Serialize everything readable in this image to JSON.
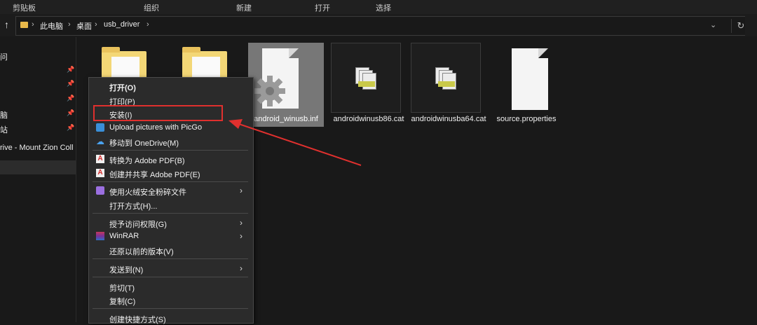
{
  "ribbon": [
    "剪贴板",
    "组织",
    "新建",
    "打开",
    "选择"
  ],
  "breadcrumb": [
    "此电脑",
    "桌面",
    "usb_driver"
  ],
  "nav": {
    "items": [
      {
        "label": "问",
        "pinned": false
      },
      {
        "label": "",
        "pinned": true
      },
      {
        "label": "",
        "pinned": true
      },
      {
        "label": "",
        "pinned": true
      },
      {
        "label": "脑",
        "pinned": true
      },
      {
        "label": "站",
        "pinned": true
      },
      {
        "label": "rive - Mount Zion Coll",
        "pinned": false
      },
      {
        "label": "",
        "pinned": false
      }
    ]
  },
  "files": [
    {
      "name": "",
      "type": "folder"
    },
    {
      "name": "",
      "type": "folder"
    },
    {
      "name": "android_winusb.inf",
      "type": "inf"
    },
    {
      "name": "androidwinusb86.cat",
      "type": "cat"
    },
    {
      "name": "androidwinusba64.cat",
      "type": "cat"
    },
    {
      "name": "source.properties",
      "type": "document"
    }
  ],
  "menu": {
    "items": [
      {
        "label": "打开(O)",
        "bold": true,
        "icon": "",
        "arrow": false
      },
      {
        "label": "打印(P)",
        "icon": "",
        "arrow": false
      },
      {
        "label": "安装(I)",
        "icon": "",
        "arrow": false
      },
      {
        "label": "Upload pictures with PicGo",
        "icon": "picgo-icon",
        "arrow": false
      },
      {
        "label": "移动到 OneDrive(M)",
        "icon": "onedrive-icon",
        "arrow": false
      },
      {
        "sep": true
      },
      {
        "label": "转换为 Adobe PDF(B)",
        "icon": "adobe-pdf-icon",
        "arrow": false
      },
      {
        "label": "创建并共享 Adobe PDF(E)",
        "icon": "adobe-pdf-share-icon",
        "arrow": false
      },
      {
        "sep": true
      },
      {
        "label": "使用火绒安全粉碎文件",
        "icon": "huorong-icon",
        "arrow": true
      },
      {
        "label": "打开方式(H)...",
        "icon": "",
        "arrow": false
      },
      {
        "sep": true
      },
      {
        "label": "授予访问权限(G)",
        "icon": "",
        "arrow": true
      },
      {
        "label": "WinRAR",
        "icon": "winrar-icon",
        "arrow": true
      },
      {
        "label": "还原以前的版本(V)",
        "icon": "",
        "arrow": false
      },
      {
        "sep": true
      },
      {
        "label": "发送到(N)",
        "icon": "",
        "arrow": true
      },
      {
        "sep": true
      },
      {
        "label": "剪切(T)",
        "icon": "",
        "arrow": false
      },
      {
        "label": "复制(C)",
        "icon": "",
        "arrow": false
      },
      {
        "sep": true
      },
      {
        "label": "创建快捷方式(S)",
        "icon": "",
        "arrow": false
      }
    ]
  },
  "colors": {
    "highlight": "#e0302e",
    "background": "#191919"
  }
}
